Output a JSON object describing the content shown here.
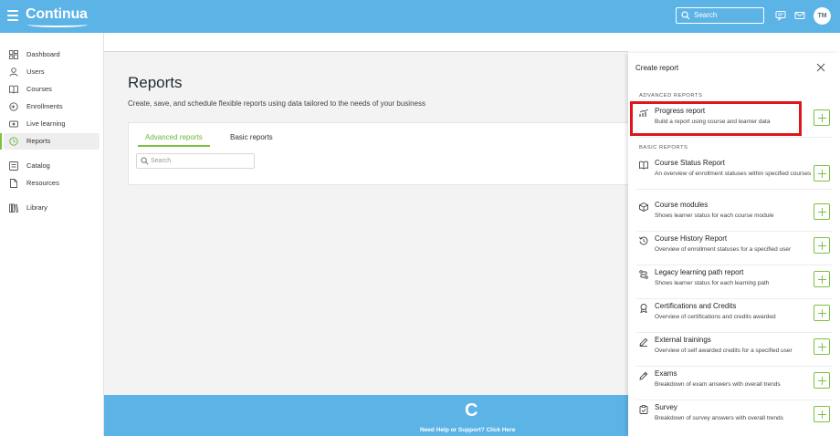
{
  "header": {
    "logo": "Continua",
    "search_placeholder": "Search",
    "avatar_initials": "TM"
  },
  "sidebar": {
    "items": [
      {
        "label": "Dashboard",
        "icon": "dashboard-icon"
      },
      {
        "label": "Users",
        "icon": "user-icon"
      },
      {
        "label": "Courses",
        "icon": "book-icon"
      },
      {
        "label": "Enrollments",
        "icon": "enroll-icon"
      },
      {
        "label": "Live learning",
        "icon": "live-icon"
      },
      {
        "label": "Reports",
        "icon": "reports-icon",
        "active": true
      },
      {
        "label": "Catalog",
        "icon": "catalog-icon"
      },
      {
        "label": "Resources",
        "icon": "file-icon"
      },
      {
        "label": "Library",
        "icon": "library-icon"
      }
    ]
  },
  "main": {
    "title": "Reports",
    "description": "Create, save, and schedule flexible reports using data tailored to the needs of your business",
    "tabs": [
      {
        "label": "Advanced reports",
        "active": true
      },
      {
        "label": "Basic reports",
        "active": false
      }
    ],
    "search_placeholder": "Search",
    "footer": {
      "logo_glyph": "C",
      "help_text": "Need Help or Support? Click Here"
    }
  },
  "panel": {
    "title": "Create report",
    "advanced_header": "ADVANCED REPORTS",
    "basic_header": "BASIC REPORTS",
    "advanced": [
      {
        "name": "Progress report",
        "desc": "Build a report using course and learner data",
        "icon": "chart-icon"
      }
    ],
    "basic": [
      {
        "name": "Course Status Report",
        "desc": "An overview of enrollment statuses within specified courses",
        "icon": "book-icon"
      },
      {
        "name": "Course modules",
        "desc": "Shows learner status for each course module",
        "icon": "cube-icon"
      },
      {
        "name": "Course History Report",
        "desc": "Overview of enrollment statuses for a specified user",
        "icon": "history-icon"
      },
      {
        "name": "Legacy learning path report",
        "desc": "Shows learner status for each learning path",
        "icon": "path-icon"
      },
      {
        "name": "Certifications and Credits",
        "desc": "Overview of certifications and credits awarded",
        "icon": "award-icon"
      },
      {
        "name": "External trainings",
        "desc": "Overview of self awarded credits for a specified user",
        "icon": "pencil-icon"
      },
      {
        "name": "Exams",
        "desc": "Breakdown of exam answers with overall trends",
        "icon": "pen-icon"
      },
      {
        "name": "Survey",
        "desc": "Breakdown of survey answers with overall trends",
        "icon": "clipboard-icon"
      }
    ]
  },
  "colors": {
    "brand_blue": "#5cb3e6",
    "accent_green": "#7cc142",
    "highlight_red": "#e0141b"
  }
}
